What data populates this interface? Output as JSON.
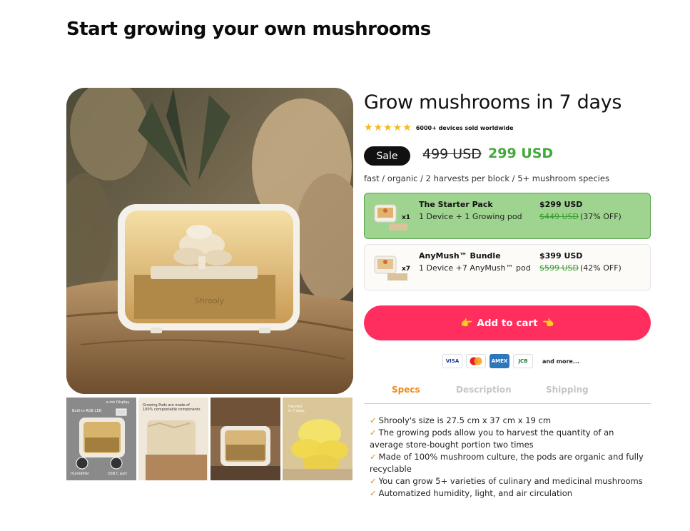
{
  "page": {
    "title": "Start growing your own mushrooms"
  },
  "product": {
    "title": "Grow mushrooms in 7 days",
    "rating_stars": 5,
    "rating_text": "6000+ devices sold worldwide",
    "sale_label": "Sale",
    "old_price": "499 USD",
    "new_price": "299 USD",
    "tagline": "fast / organic / 2 harvests per block / 5+ mushroom species"
  },
  "gallery": {
    "thumbs": [
      {
        "captions": [
          "e-ink Display",
          "Built-in RGB LED",
          "Humidifier",
          "USB C port"
        ]
      },
      {
        "captions": [
          "Growing Pods are made of",
          "100% compostable components"
        ]
      },
      {
        "captions": []
      },
      {
        "captions": [
          "Harvest",
          "in 7 days"
        ]
      }
    ]
  },
  "bundles": [
    {
      "name": "The Starter Pack",
      "desc": "1 Device + 1 Growing pod",
      "price": "$299 USD",
      "old_price": "$449 USD",
      "off": "(37% OFF)",
      "qty": "x1",
      "selected": true
    },
    {
      "name": "AnyMush™ Bundle",
      "desc": "1 Device +7 AnyMush™ pod",
      "price": "$399 USD",
      "old_price": "$599 USD",
      "off": "(42% OFF)",
      "qty": "x7",
      "selected": false
    }
  ],
  "cart": {
    "label": "Add to cart",
    "emoji_left": "👉",
    "emoji_right": "👈"
  },
  "payments": {
    "visa": "VISA",
    "amex": "AMEX",
    "jcb": "JCB",
    "more": "and more..."
  },
  "tabs": [
    {
      "label": "Specs",
      "active": true
    },
    {
      "label": "Description",
      "active": false
    },
    {
      "label": "Shipping",
      "active": false
    }
  ],
  "specs": [
    "Shrooly's size is 27.5 cm x 37 cm x 19 cm",
    "The growing pods allow you to harvest the quantity of an average store-bought portion two times",
    "Made of 100% mushroom culture, the pods are organic and fully recyclable",
    "You can grow 5+ varieties of culinary and medicinal mushrooms",
    "Automatized humidity, light, and air circulation"
  ],
  "check_mark": "✓",
  "colors": {
    "accent": "#f08a1c",
    "cart": "#ff2e5f",
    "sale_price": "#44a83a",
    "selected_bundle": "#9ed48f",
    "star": "#f6b91c"
  }
}
